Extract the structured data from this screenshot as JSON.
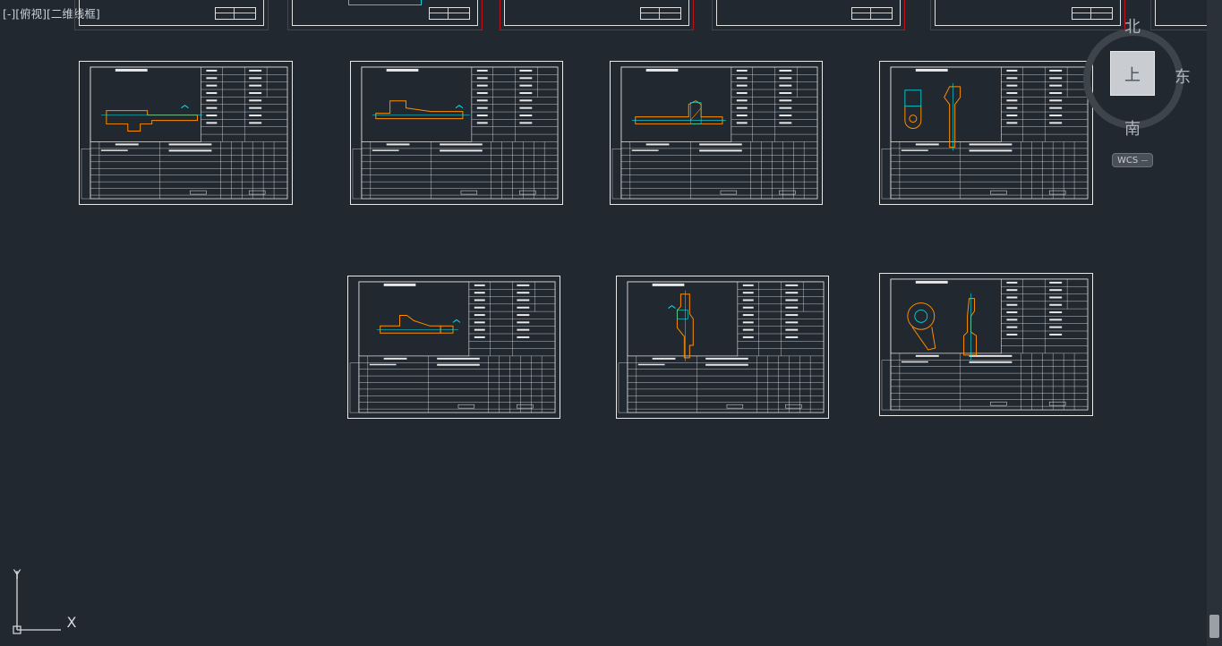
{
  "viewport": {
    "controls_label": "[-]",
    "view_label": "[俯视]",
    "style_label": "[二维线框]"
  },
  "viewcube": {
    "face_label": "上",
    "north": "北",
    "east": "东",
    "south": "南",
    "wcs_label": "WCS"
  },
  "ucs": {
    "x_label": "X",
    "y_label": "Y"
  },
  "layout_colors": {
    "background": "#212830",
    "frame": "#e8e8e8",
    "part_outline": "#ff8c00",
    "dimension": "#00ffff",
    "sheet_border_red": "#c0101a"
  },
  "drawing_sheets": [
    {
      "id": "sheet-1",
      "part": "flange-profile"
    },
    {
      "id": "sheet-2",
      "part": "stepped-profile"
    },
    {
      "id": "sheet-3",
      "part": "bracket-profile"
    },
    {
      "id": "sheet-4",
      "part": "fork-and-lever"
    },
    {
      "id": "sheet-5",
      "part": "stepped-shaft"
    },
    {
      "id": "sheet-6",
      "part": "vertical-lever"
    },
    {
      "id": "sheet-7",
      "part": "circular-boss-lever"
    }
  ]
}
